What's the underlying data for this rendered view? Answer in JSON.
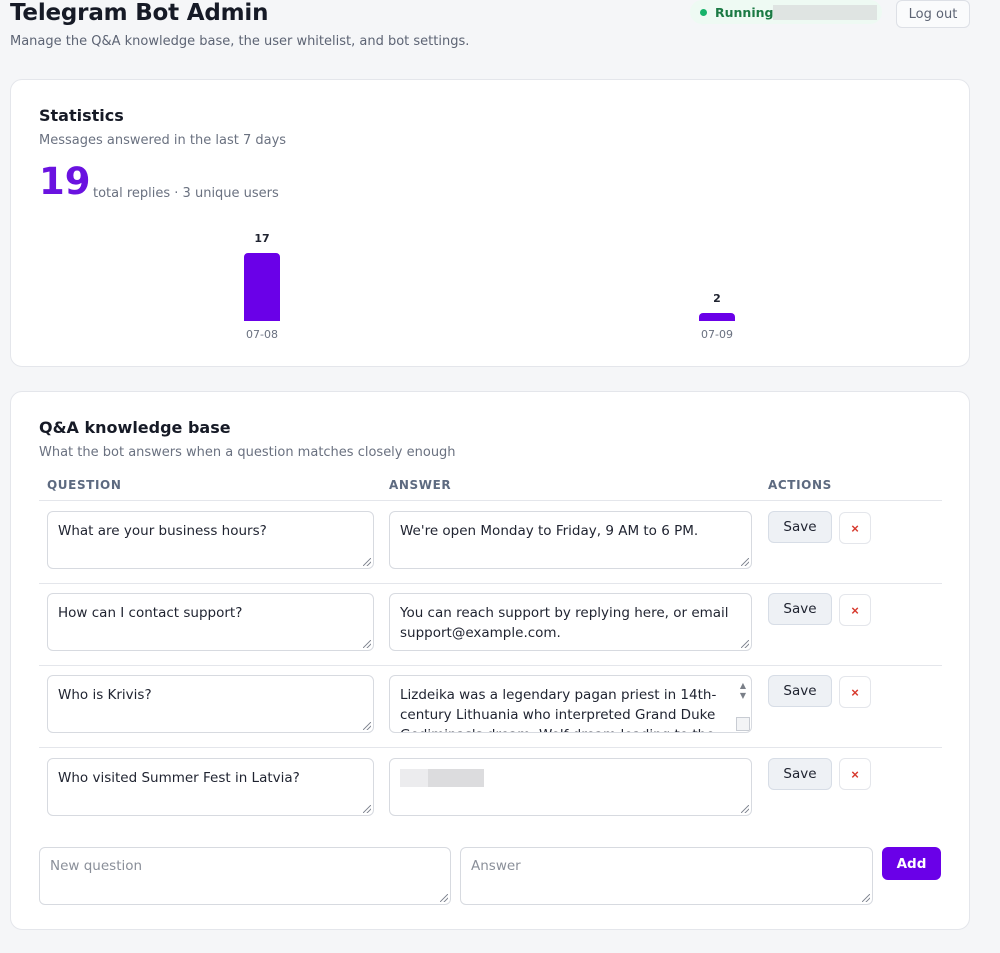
{
  "header": {
    "title": "Telegram Bot Admin",
    "subtitle": "Manage the Q&A knowledge base, the user whitelist, and bot settings.",
    "status_label": "Running",
    "status_color": "#16b36a",
    "logout_label": "Log out"
  },
  "stats": {
    "title": "Statistics",
    "subtitle": "Messages answered in the last 7 days",
    "total": "19",
    "caption": "total replies · 3 unique users"
  },
  "chart_data": {
    "type": "bar",
    "categories": [
      "07-08",
      "07-09"
    ],
    "values": [
      17,
      2
    ],
    "color": "#6a00e8"
  },
  "qa": {
    "title": "Q&A knowledge base",
    "subtitle": "What the bot answers when a question matches closely enough",
    "columns": {
      "question": "QUESTION",
      "answer": "ANSWER",
      "actions": "ACTIONS"
    },
    "rows": [
      {
        "question": "What are your business hours?",
        "answer": "We're open Monday to Friday, 9 AM to 6 PM."
      },
      {
        "question": "How can I contact support?",
        "answer": "You can reach support by replying here, or email support@example.com."
      },
      {
        "question": "Who is Krivis?",
        "answer": "Lizdeika was a legendary pagan priest in 14th-century Lithuania who interpreted Grand Duke Gediminas's dream. Wolf dream leading to the"
      },
      {
        "question": "Who visited Summer Fest in Latvia?",
        "answer": ""
      }
    ],
    "save_label": "Save",
    "delete_label": "×",
    "new_question_placeholder": "New question",
    "new_answer_placeholder": "Answer",
    "add_label": "Add"
  }
}
